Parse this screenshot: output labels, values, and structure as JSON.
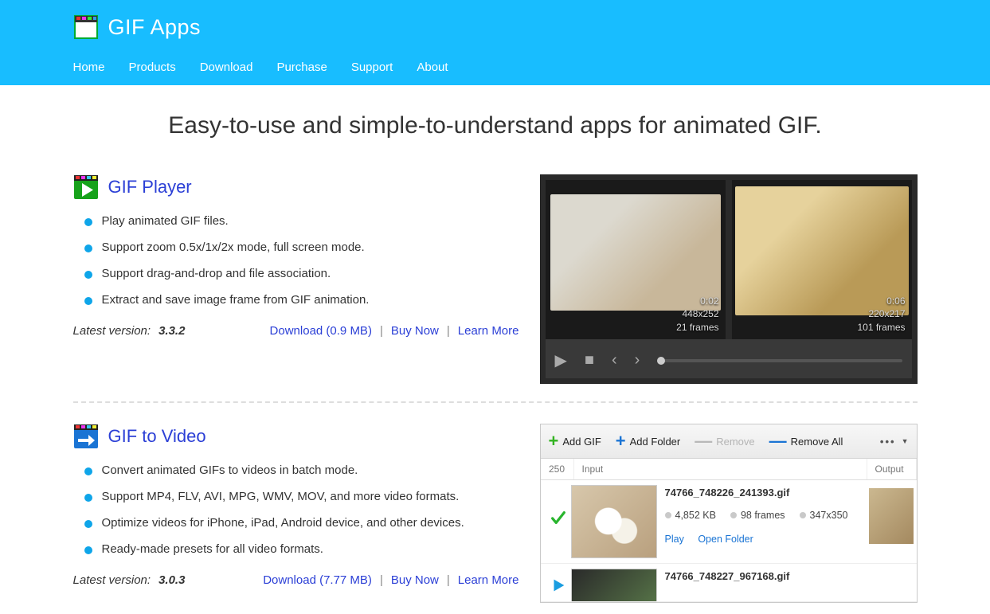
{
  "brand": {
    "title": "GIF Apps"
  },
  "nav": [
    "Home",
    "Products",
    "Download",
    "Purchase",
    "Support",
    "About"
  ],
  "hero": {
    "headline": "Easy-to-use and simple-to-understand apps for animated GIF."
  },
  "products": {
    "player": {
      "title": "GIF Player",
      "features": [
        "Play animated GIF files.",
        "Support zoom 0.5x/1x/2x mode, full screen mode.",
        "Support drag-and-drop and file association.",
        "Extract and save image frame from GIF animation."
      ],
      "latest_label": "Latest version:",
      "version": "3.3.2",
      "download": "Download (0.9 MB)",
      "buy": "Buy Now",
      "learn": "Learn More",
      "thumbs": [
        {
          "time": "0:02",
          "dim": "448x252",
          "frames": "21 frames"
        },
        {
          "time": "0:06",
          "dim": "220x217",
          "frames": "101 frames"
        }
      ]
    },
    "g2v": {
      "title": "GIF to Video",
      "features": [
        "Convert animated GIFs to videos in batch mode.",
        "Support MP4, FLV, AVI, MPG, WMV, MOV, and more video formats.",
        "Optimize videos for iPhone, iPad, Android device, and other devices.",
        "Ready-made presets for all video formats."
      ],
      "latest_label": "Latest version:",
      "version": "3.0.3",
      "download": "Download (7.77 MB)",
      "buy": "Buy Now",
      "learn": "Learn More",
      "toolbar": {
        "add_gif": "Add GIF",
        "add_folder": "Add Folder",
        "remove": "Remove",
        "remove_all": "Remove All"
      },
      "columns": {
        "a": "250",
        "b": "Input",
        "c": "Output"
      },
      "rows": [
        {
          "name": "74766_748226_241393.gif",
          "size": "4,852 KB",
          "frames": "98 frames",
          "dim": "347x350",
          "play": "Play",
          "open": "Open Folder"
        },
        {
          "name": "74766_748227_967168.gif"
        }
      ]
    }
  }
}
